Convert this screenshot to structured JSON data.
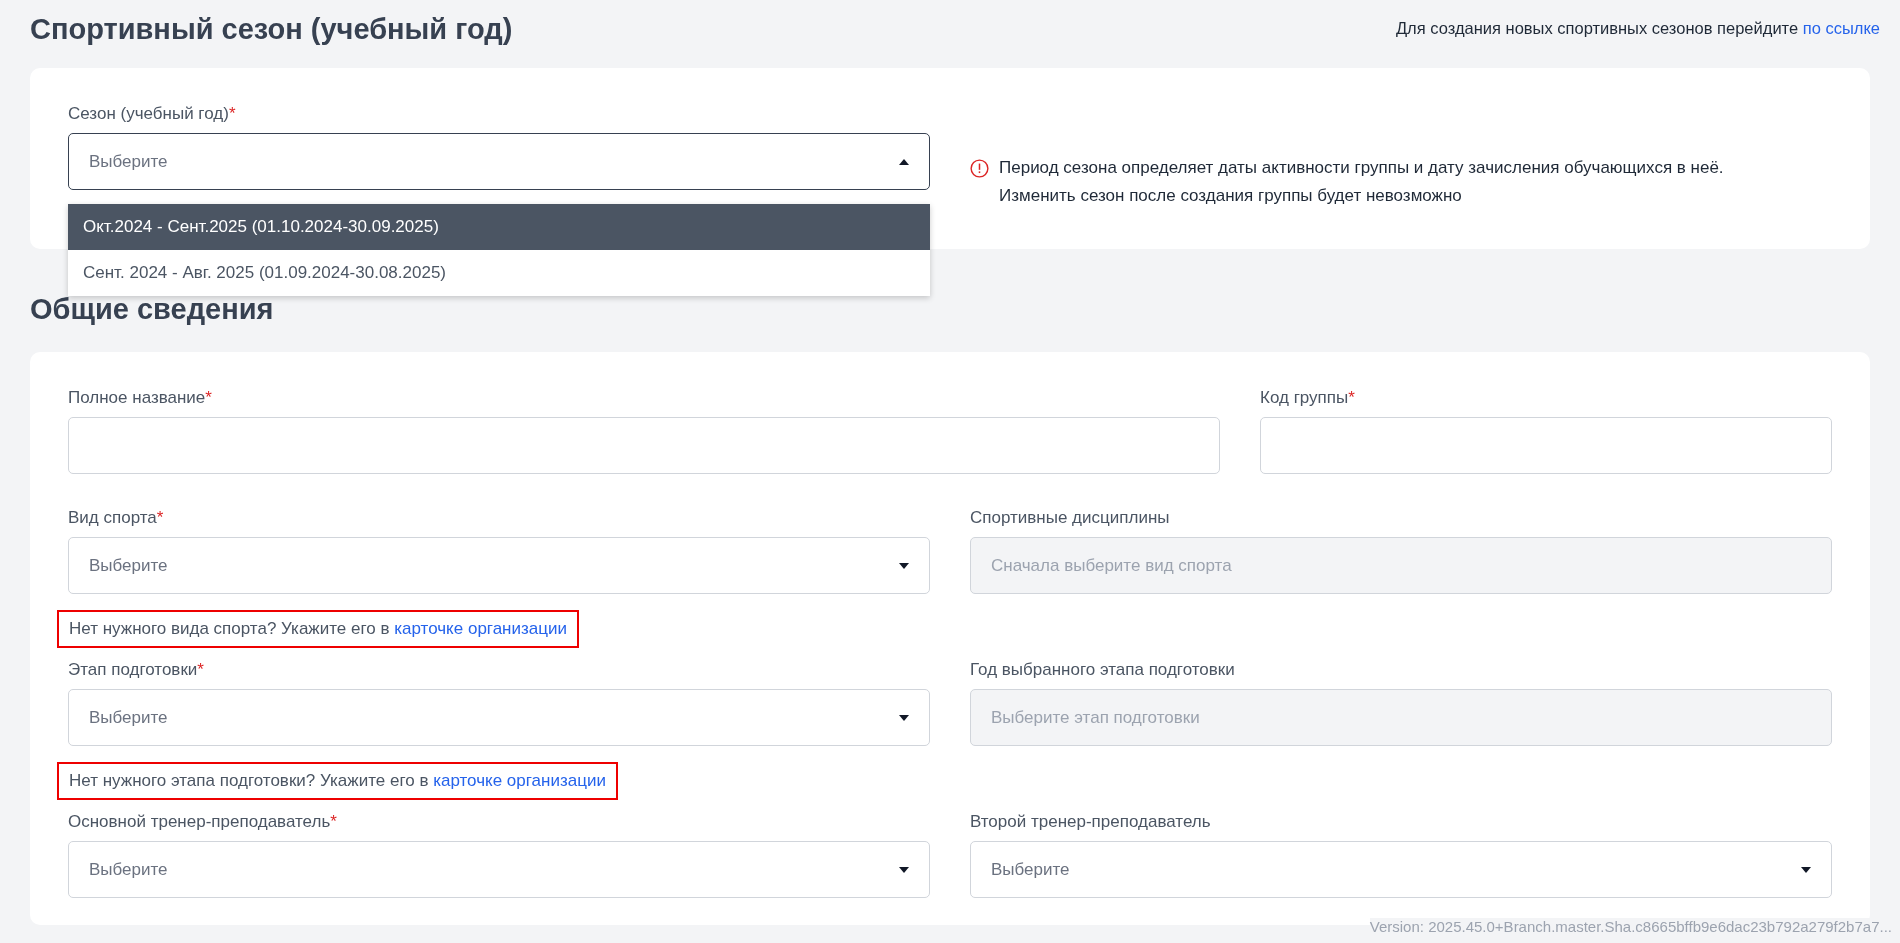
{
  "header": {
    "title": "Спортивный сезон (учебный год)",
    "note": "Для создания новых спортивных сезонов перейдите",
    "note_link": "по ссылке"
  },
  "season": {
    "label": "Сезон (учебный год)",
    "required_mark": "*",
    "placeholder": "Выберите",
    "expanded": true,
    "info": [
      "Период сезона определяет даты активности группы и дату зачисления обучающихся в неё.",
      "Изменить сезон после создания группы будет невозможно"
    ],
    "options": [
      {
        "label": "Окт.2024 - Сент.2025 (01.10.2024-30.09.2025)",
        "selected": true
      },
      {
        "label": "Сент. 2024 - Авг. 2025 (01.09.2024-30.08.2025)",
        "selected": false
      }
    ]
  },
  "general": {
    "title": "Общие сведения",
    "rows": [
      {
        "kind": "wide",
        "fields": [
          {
            "kind": "input",
            "label": "Полное название",
            "required_mark": "*"
          },
          {
            "kind": "input",
            "label": "Код группы",
            "required_mark": "*"
          }
        ]
      },
      {
        "kind": "pair",
        "fields": [
          {
            "kind": "select",
            "label": "Вид спорта",
            "required_mark": "*",
            "placeholder": "Выберите"
          },
          {
            "kind": "disabled",
            "label": "Спортивные дисциплины",
            "placeholder": "Сначала выберите вид спорта"
          }
        ],
        "hint": {
          "text": "Нет нужного вида спорта? Укажите его в",
          "link": "карточке организации",
          "highlighted": true
        }
      },
      {
        "kind": "pair",
        "fields": [
          {
            "kind": "select",
            "label": "Этап подготовки",
            "required_mark": "*",
            "placeholder": "Выберите"
          },
          {
            "kind": "disabled",
            "label": "Год выбранного этапа подготовки",
            "placeholder": "Выберите этап подготовки"
          }
        ],
        "hint": {
          "text": "Нет нужного этапа подготовки? Укажите его в",
          "link": "карточке организации",
          "highlighted": true
        }
      },
      {
        "kind": "pair",
        "fields": [
          {
            "kind": "select",
            "label": "Основной тренер-преподаватель",
            "required_mark": "*",
            "placeholder": "Выберите"
          },
          {
            "kind": "select",
            "label": "Второй тренер-преподаватель",
            "placeholder": "Выберите"
          }
        ]
      }
    ]
  },
  "version": "Version: 2025.45.0+Branch.master.Sha.c8665bffb9e6dac23b792a279f2b7a7..."
}
